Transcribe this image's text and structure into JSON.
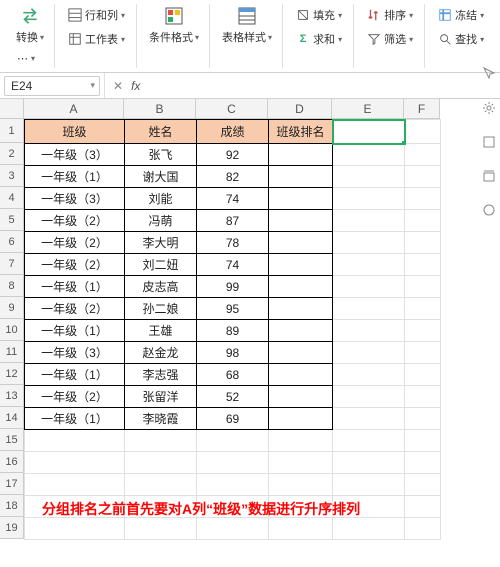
{
  "ribbon": {
    "convert": "转换",
    "rowcol": "行和列",
    "worksheet": "工作表",
    "cond_format": "条件格式",
    "table_style": "表格样式",
    "fill": "填充",
    "sum": "求和",
    "sort": "排序",
    "filter": "筛选",
    "freeze": "冻结",
    "find": "查找"
  },
  "namebox": {
    "value": "E24"
  },
  "fx": {
    "label": "fx"
  },
  "columns": [
    "A",
    "B",
    "C",
    "D",
    "E",
    "F"
  ],
  "row_count": 19,
  "headers": {
    "class": "班级",
    "name": "姓名",
    "score": "成绩",
    "rank": "班级排名"
  },
  "rows": [
    {
      "class": "一年级（3）",
      "name": "张飞",
      "score": "92",
      "rank": ""
    },
    {
      "class": "一年级（1）",
      "name": "谢大国",
      "score": "82",
      "rank": ""
    },
    {
      "class": "一年级（3）",
      "name": "刘能",
      "score": "74",
      "rank": ""
    },
    {
      "class": "一年级（2）",
      "name": "冯萌",
      "score": "87",
      "rank": ""
    },
    {
      "class": "一年级（2）",
      "name": "李大明",
      "score": "78",
      "rank": ""
    },
    {
      "class": "一年级（2）",
      "name": "刘二妞",
      "score": "74",
      "rank": ""
    },
    {
      "class": "一年级（1）",
      "name": "皮志高",
      "score": "99",
      "rank": ""
    },
    {
      "class": "一年级（2）",
      "name": "孙二娘",
      "score": "95",
      "rank": ""
    },
    {
      "class": "一年级（1）",
      "name": "王雄",
      "score": "89",
      "rank": ""
    },
    {
      "class": "一年级（3）",
      "name": "赵金龙",
      "score": "98",
      "rank": ""
    },
    {
      "class": "一年级（1）",
      "name": "李志强",
      "score": "68",
      "rank": ""
    },
    {
      "class": "一年级（2）",
      "name": "张留洋",
      "score": "52",
      "rank": ""
    },
    {
      "class": "一年级（1）",
      "name": "李晓霞",
      "score": "69",
      "rank": ""
    }
  ],
  "annotation": "分组排名之前首先要对A列“班级”数据进行升序排列",
  "selection": {
    "cell": "E1"
  }
}
